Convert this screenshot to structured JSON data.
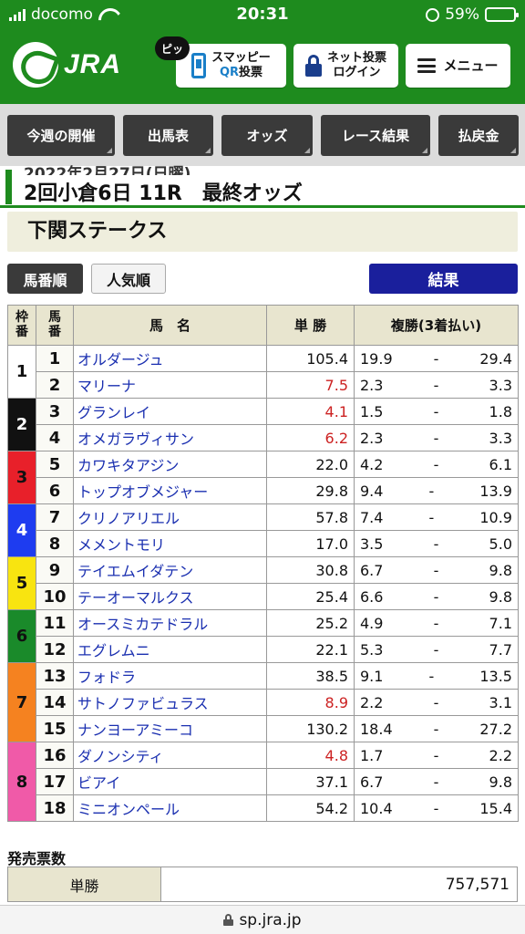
{
  "status_bar": {
    "carrier": "docomo",
    "time": "20:31",
    "battery": "59%",
    "battery_level": 0.59
  },
  "header": {
    "logo_text": "JRA",
    "pip_badge": "ピッ",
    "qr_button": {
      "line1": "スマッピー",
      "line2a": "QR",
      "line2b": "投票"
    },
    "net_button": {
      "line1": "ネット投票",
      "line2": "ログイン"
    },
    "menu_button": "メニュー"
  },
  "nav": [
    "今週の開催",
    "出馬表",
    "オッズ",
    "レース結果",
    "払戻金"
  ],
  "race": {
    "date": "2022年2月27日(日曜)",
    "title": "2回小倉6日 11R　最終オッズ",
    "stakes_name": "下関ステークス"
  },
  "sort": {
    "by_number": "馬番順",
    "by_popularity": "人気順",
    "result": "結果"
  },
  "table": {
    "headers": {
      "waku_1": "枠",
      "waku_2": "番",
      "uma_1": "馬",
      "uma_2": "番",
      "name": "馬　名",
      "win": "単 勝",
      "place": "複勝(3着払い)"
    },
    "waku": [
      {
        "label": "1",
        "color": "#ffffff",
        "text": "#111111",
        "rows": 2
      },
      {
        "label": "2",
        "color": "#111111",
        "text": "#ffffff",
        "rows": 2
      },
      {
        "label": "3",
        "color": "#e8202a",
        "text": "#111111",
        "rows": 2
      },
      {
        "label": "4",
        "color": "#1e3cf0",
        "text": "#ffffff",
        "rows": 2
      },
      {
        "label": "5",
        "color": "#f8e410",
        "text": "#111111",
        "rows": 2
      },
      {
        "label": "6",
        "color": "#1a8a2a",
        "text": "#111111",
        "rows": 2
      },
      {
        "label": "7",
        "color": "#f58220",
        "text": "#111111",
        "rows": 3
      },
      {
        "label": "8",
        "color": "#f05aa8",
        "text": "#111111",
        "rows": 3
      }
    ],
    "rows": [
      {
        "num": "1",
        "name": "オルダージュ",
        "win": "105.4",
        "hot": false,
        "place_min": "19.9",
        "place_max": "29.4"
      },
      {
        "num": "2",
        "name": "マリーナ",
        "win": "7.5",
        "hot": true,
        "place_min": "2.3",
        "place_max": "3.3"
      },
      {
        "num": "3",
        "name": "グランレイ",
        "win": "4.1",
        "hot": true,
        "place_min": "1.5",
        "place_max": "1.8"
      },
      {
        "num": "4",
        "name": "オメガラヴィサン",
        "win": "6.2",
        "hot": true,
        "place_min": "2.3",
        "place_max": "3.3"
      },
      {
        "num": "5",
        "name": "カワキタアジン",
        "win": "22.0",
        "hot": false,
        "place_min": "4.2",
        "place_max": "6.1"
      },
      {
        "num": "6",
        "name": "トップオブメジャー",
        "win": "29.8",
        "hot": false,
        "place_min": "9.4",
        "place_max": "13.9"
      },
      {
        "num": "7",
        "name": "クリノアリエル",
        "win": "57.8",
        "hot": false,
        "place_min": "7.4",
        "place_max": "10.9"
      },
      {
        "num": "8",
        "name": "メメントモリ",
        "win": "17.0",
        "hot": false,
        "place_min": "3.5",
        "place_max": "5.0"
      },
      {
        "num": "9",
        "name": "テイエムイダテン",
        "win": "30.8",
        "hot": false,
        "place_min": "6.7",
        "place_max": "9.8"
      },
      {
        "num": "10",
        "name": "テーオーマルクス",
        "win": "25.4",
        "hot": false,
        "place_min": "6.6",
        "place_max": "9.8"
      },
      {
        "num": "11",
        "name": "オースミカテドラル",
        "win": "25.2",
        "hot": false,
        "place_min": "4.9",
        "place_max": "7.1"
      },
      {
        "num": "12",
        "name": "エグレムニ",
        "win": "22.1",
        "hot": false,
        "place_min": "5.3",
        "place_max": "7.7"
      },
      {
        "num": "13",
        "name": "フォドラ",
        "win": "38.5",
        "hot": false,
        "place_min": "9.1",
        "place_max": "13.5"
      },
      {
        "num": "14",
        "name": "サトノファビュラス",
        "win": "8.9",
        "hot": true,
        "place_min": "2.2",
        "place_max": "3.1"
      },
      {
        "num": "15",
        "name": "ナンヨーアミーコ",
        "win": "130.2",
        "hot": false,
        "place_min": "18.4",
        "place_max": "27.2"
      },
      {
        "num": "16",
        "name": "ダノンシティ",
        "win": "4.8",
        "hot": true,
        "place_min": "1.7",
        "place_max": "2.2"
      },
      {
        "num": "17",
        "name": "ビアイ",
        "win": "37.1",
        "hot": false,
        "place_min": "6.7",
        "place_max": "9.8"
      },
      {
        "num": "18",
        "name": "ミニオンペール",
        "win": "54.2",
        "hot": false,
        "place_min": "10.4",
        "place_max": "15.4"
      }
    ],
    "place_separator": "-"
  },
  "sales": {
    "title": "発売票数",
    "rows": [
      {
        "label": "単勝",
        "value": "757,571"
      }
    ]
  },
  "url_bar": {
    "url": "sp.jra.jp"
  },
  "colors": {
    "brand_green": "#1e8b1e",
    "nav_dark": "#3a3a3a",
    "result_blue": "#1a1f9c",
    "link_blue": "#1a2fb0",
    "hot_red": "#cc2222",
    "header_beige": "#e8e5cf"
  }
}
